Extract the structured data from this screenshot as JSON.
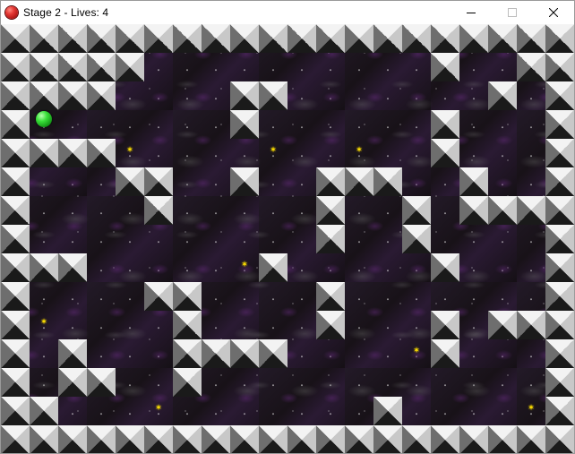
{
  "window": {
    "title": "Stage 2 - Lives: 4",
    "app_icon": "red-ball-icon",
    "controls": {
      "minimize_icon": "minimize-icon",
      "maximize_icon": "maximize-icon",
      "close_icon": "close-icon"
    }
  },
  "game": {
    "grid_columns": 20,
    "grid_rows": 15,
    "maze_rows": [
      "####################",
      "#####..........#..##",
      "####....##.......#.#",
      "#.......#......#...#",
      "####...........#...#",
      "#...##..#..###..#..#",
      "#....#.....#..#.####",
      "#..........#..#....#",
      "###......#.....#...#",
      "#....##....#.......#",
      "#.....#....#...#.###",
      "#.#...####.....#...#",
      "#.##..#............#",
      "##...........#.....#",
      "####################"
    ],
    "stars": [
      [
        4,
        4
      ],
      [
        9,
        4
      ],
      [
        12,
        4
      ],
      [
        8,
        8
      ],
      [
        1,
        10
      ],
      [
        14,
        11
      ],
      [
        5,
        13
      ],
      [
        18,
        13
      ]
    ],
    "player": [
      1,
      3
    ],
    "colors": {
      "player": "#3ae03a",
      "star": "#ffe100",
      "wall_light": "#f3f3f3",
      "wall_dark": "#1a1a1a",
      "background": "#1c1420"
    }
  }
}
